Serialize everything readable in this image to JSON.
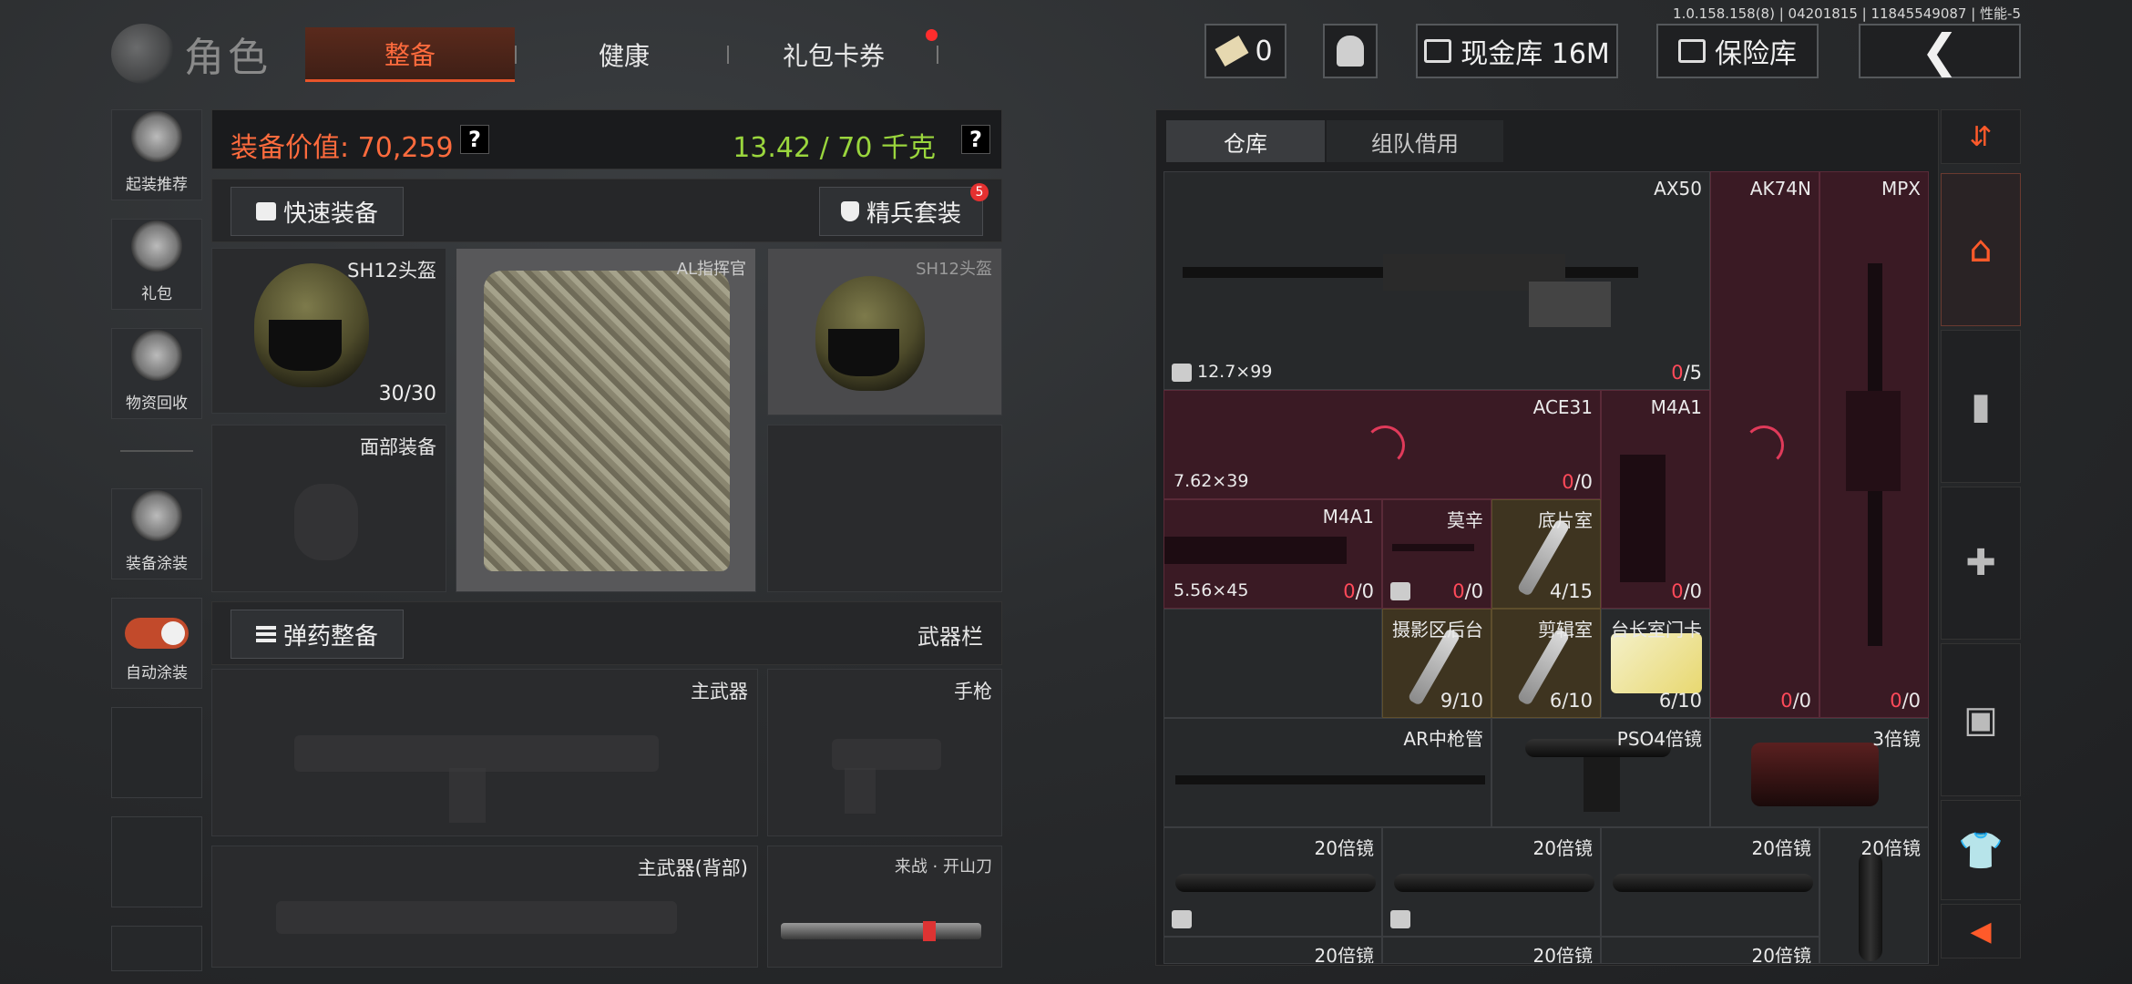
{
  "version": "1.0.158.158(8) | 04201815 | 11845549087 | 性能-5",
  "header": {
    "title": "角色",
    "tabs": [
      {
        "label": "整备",
        "active": true
      },
      {
        "label": "健康",
        "active": false
      },
      {
        "label": "礼包卡券",
        "active": false,
        "notify": true
      }
    ],
    "ticket_count": "0",
    "cash_vault": "现金库 16M",
    "insurance": "保险库"
  },
  "sidebar": [
    {
      "label": "起装推荐",
      "icon": "recommend-icon"
    },
    {
      "label": "礼包",
      "icon": "gift-icon"
    },
    {
      "label": "物资回收",
      "icon": "recycle-icon"
    },
    {
      "label": "装备涂装",
      "icon": "paint-icon"
    },
    {
      "label": "自动涂装",
      "icon": "toggle-icon",
      "toggle_on": true
    }
  ],
  "equipment": {
    "value_label": "装备价值: 70,259",
    "weight_label": "13.42 / 70 千克",
    "quick_equip": "快速装备",
    "elite_set": "精兵套装",
    "elite_badge": "5",
    "slots": {
      "helmet_name": "SH12头盔",
      "helmet_durability": "30/30",
      "face_label": "面部装备",
      "armor_name": "AL指挥官",
      "helmet2_name": "SH12头盔"
    },
    "ammo_btn": "弹药整备",
    "weapon_bar": "武器栏",
    "primary": "主武器",
    "pistol": "手枪",
    "primary_back": "主武器(背部)",
    "melee": "来战 · 开山刀"
  },
  "warehouse": {
    "tabs": [
      "仓库",
      "组队借用"
    ],
    "items": [
      {
        "name": "AX50",
        "caliber": "12.7×99",
        "count_a": "0",
        "count_b": "/5"
      },
      {
        "name": "AK74N",
        "count_a": "0",
        "count_b": "/0"
      },
      {
        "name": "MPX",
        "count_a": "0",
        "count_b": "/0"
      },
      {
        "name": "ACE31",
        "caliber": "7.62×39",
        "count_a": "0",
        "count_b": "/0"
      },
      {
        "name": "M4A1",
        "count_a": "0",
        "count_b": "/0"
      },
      {
        "name": "M4A1",
        "caliber": "5.56×45",
        "count_a": "0",
        "count_b": "/0"
      },
      {
        "name": "莫辛",
        "count_a": "0",
        "count_b": "/0"
      },
      {
        "name": "底片室",
        "count": "4/15"
      },
      {
        "name": "摄影区后台",
        "count": "9/10"
      },
      {
        "name": "剪辑室",
        "count": "6/10"
      },
      {
        "name": "台长室门卡",
        "count": "6/10"
      },
      {
        "name": "AR中枪管"
      },
      {
        "name": "PSO4倍镜"
      },
      {
        "name": "3倍镜"
      },
      {
        "name": "20倍镜"
      },
      {
        "name": "20倍镜"
      },
      {
        "name": "20倍镜"
      },
      {
        "name": "20倍镜"
      },
      {
        "name": "20倍镜"
      },
      {
        "name": "20倍镜"
      },
      {
        "name": "20倍镜"
      }
    ]
  },
  "colors": {
    "accent": "#ff6b3d",
    "weight_green": "#9ad63d",
    "alert_red": "#ff4a5a"
  }
}
